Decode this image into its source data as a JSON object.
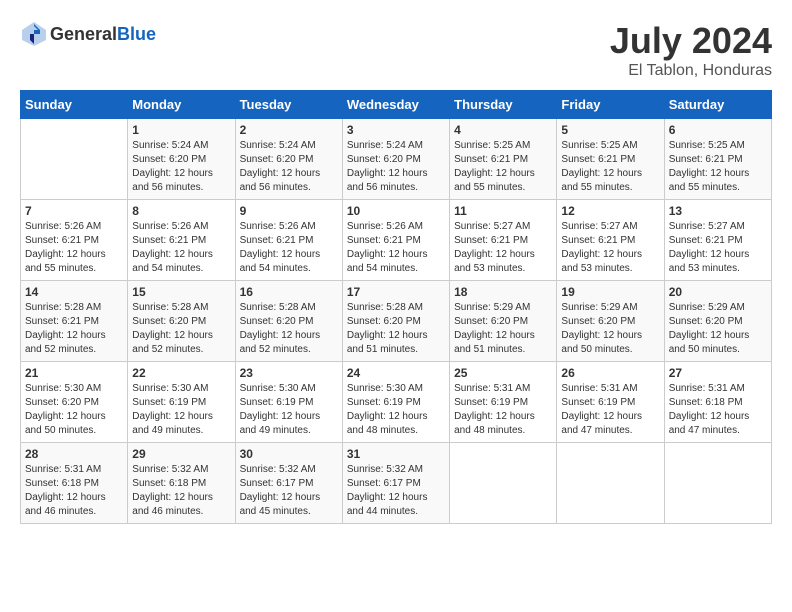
{
  "header": {
    "logo_general": "General",
    "logo_blue": "Blue",
    "month_year": "July 2024",
    "location": "El Tablon, Honduras"
  },
  "calendar": {
    "days_of_week": [
      "Sunday",
      "Monday",
      "Tuesday",
      "Wednesday",
      "Thursday",
      "Friday",
      "Saturday"
    ],
    "weeks": [
      [
        {
          "date": "",
          "sunrise": "",
          "sunset": "",
          "daylight": "",
          "minutes": ""
        },
        {
          "date": "1",
          "sunrise": "5:24 AM",
          "sunset": "6:20 PM",
          "daylight": "12 hours",
          "minutes": "and 56 minutes."
        },
        {
          "date": "2",
          "sunrise": "5:24 AM",
          "sunset": "6:20 PM",
          "daylight": "12 hours",
          "minutes": "and 56 minutes."
        },
        {
          "date": "3",
          "sunrise": "5:24 AM",
          "sunset": "6:20 PM",
          "daylight": "12 hours",
          "minutes": "and 56 minutes."
        },
        {
          "date": "4",
          "sunrise": "5:25 AM",
          "sunset": "6:21 PM",
          "daylight": "12 hours",
          "minutes": "and 55 minutes."
        },
        {
          "date": "5",
          "sunrise": "5:25 AM",
          "sunset": "6:21 PM",
          "daylight": "12 hours",
          "minutes": "and 55 minutes."
        },
        {
          "date": "6",
          "sunrise": "5:25 AM",
          "sunset": "6:21 PM",
          "daylight": "12 hours",
          "minutes": "and 55 minutes."
        }
      ],
      [
        {
          "date": "7",
          "sunrise": "5:26 AM",
          "sunset": "6:21 PM",
          "daylight": "12 hours",
          "minutes": "and 55 minutes."
        },
        {
          "date": "8",
          "sunrise": "5:26 AM",
          "sunset": "6:21 PM",
          "daylight": "12 hours",
          "minutes": "and 54 minutes."
        },
        {
          "date": "9",
          "sunrise": "5:26 AM",
          "sunset": "6:21 PM",
          "daylight": "12 hours",
          "minutes": "and 54 minutes."
        },
        {
          "date": "10",
          "sunrise": "5:26 AM",
          "sunset": "6:21 PM",
          "daylight": "12 hours",
          "minutes": "and 54 minutes."
        },
        {
          "date": "11",
          "sunrise": "5:27 AM",
          "sunset": "6:21 PM",
          "daylight": "12 hours",
          "minutes": "and 53 minutes."
        },
        {
          "date": "12",
          "sunrise": "5:27 AM",
          "sunset": "6:21 PM",
          "daylight": "12 hours",
          "minutes": "and 53 minutes."
        },
        {
          "date": "13",
          "sunrise": "5:27 AM",
          "sunset": "6:21 PM",
          "daylight": "12 hours",
          "minutes": "and 53 minutes."
        }
      ],
      [
        {
          "date": "14",
          "sunrise": "5:28 AM",
          "sunset": "6:21 PM",
          "daylight": "12 hours",
          "minutes": "and 52 minutes."
        },
        {
          "date": "15",
          "sunrise": "5:28 AM",
          "sunset": "6:20 PM",
          "daylight": "12 hours",
          "minutes": "and 52 minutes."
        },
        {
          "date": "16",
          "sunrise": "5:28 AM",
          "sunset": "6:20 PM",
          "daylight": "12 hours",
          "minutes": "and 52 minutes."
        },
        {
          "date": "17",
          "sunrise": "5:28 AM",
          "sunset": "6:20 PM",
          "daylight": "12 hours",
          "minutes": "and 51 minutes."
        },
        {
          "date": "18",
          "sunrise": "5:29 AM",
          "sunset": "6:20 PM",
          "daylight": "12 hours",
          "minutes": "and 51 minutes."
        },
        {
          "date": "19",
          "sunrise": "5:29 AM",
          "sunset": "6:20 PM",
          "daylight": "12 hours",
          "minutes": "and 50 minutes."
        },
        {
          "date": "20",
          "sunrise": "5:29 AM",
          "sunset": "6:20 PM",
          "daylight": "12 hours",
          "minutes": "and 50 minutes."
        }
      ],
      [
        {
          "date": "21",
          "sunrise": "5:30 AM",
          "sunset": "6:20 PM",
          "daylight": "12 hours",
          "minutes": "and 50 minutes."
        },
        {
          "date": "22",
          "sunrise": "5:30 AM",
          "sunset": "6:19 PM",
          "daylight": "12 hours",
          "minutes": "and 49 minutes."
        },
        {
          "date": "23",
          "sunrise": "5:30 AM",
          "sunset": "6:19 PM",
          "daylight": "12 hours",
          "minutes": "and 49 minutes."
        },
        {
          "date": "24",
          "sunrise": "5:30 AM",
          "sunset": "6:19 PM",
          "daylight": "12 hours",
          "minutes": "and 48 minutes."
        },
        {
          "date": "25",
          "sunrise": "5:31 AM",
          "sunset": "6:19 PM",
          "daylight": "12 hours",
          "minutes": "and 48 minutes."
        },
        {
          "date": "26",
          "sunrise": "5:31 AM",
          "sunset": "6:19 PM",
          "daylight": "12 hours",
          "minutes": "and 47 minutes."
        },
        {
          "date": "27",
          "sunrise": "5:31 AM",
          "sunset": "6:18 PM",
          "daylight": "12 hours",
          "minutes": "and 47 minutes."
        }
      ],
      [
        {
          "date": "28",
          "sunrise": "5:31 AM",
          "sunset": "6:18 PM",
          "daylight": "12 hours",
          "minutes": "and 46 minutes."
        },
        {
          "date": "29",
          "sunrise": "5:32 AM",
          "sunset": "6:18 PM",
          "daylight": "12 hours",
          "minutes": "and 46 minutes."
        },
        {
          "date": "30",
          "sunrise": "5:32 AM",
          "sunset": "6:17 PM",
          "daylight": "12 hours",
          "minutes": "and 45 minutes."
        },
        {
          "date": "31",
          "sunrise": "5:32 AM",
          "sunset": "6:17 PM",
          "daylight": "12 hours",
          "minutes": "and 44 minutes."
        },
        {
          "date": "",
          "sunrise": "",
          "sunset": "",
          "daylight": "",
          "minutes": ""
        },
        {
          "date": "",
          "sunrise": "",
          "sunset": "",
          "daylight": "",
          "minutes": ""
        },
        {
          "date": "",
          "sunrise": "",
          "sunset": "",
          "daylight": "",
          "minutes": ""
        }
      ]
    ]
  }
}
